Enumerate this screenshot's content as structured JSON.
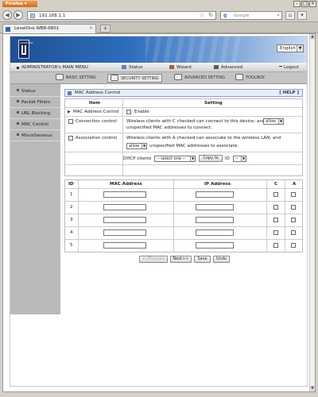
{
  "browser": {
    "app_button": "Firefox",
    "url": "192.168.1.1",
    "search_placeholder": "Google",
    "tab_title": "LevelOne WBR-6801"
  },
  "router": {
    "logo_text": "LevelOne",
    "language": "English",
    "menu": {
      "admin": "ADMINISTRATOR's MAIN MENU",
      "status": "Status",
      "wizard": "Wizard",
      "advanced": "Advanced",
      "logout": "Logout"
    },
    "subtabs": [
      "BASIC SETTING",
      "SECURITY SETTING",
      "ADVANCED SETTING",
      "TOOLBOX"
    ],
    "sidebar": [
      "Status",
      "Packet Filters",
      "URL Blocking",
      "MAC Control",
      "Miscellaneous"
    ]
  },
  "mac_control": {
    "title": "MAC Address Control",
    "help": "[ HELP ]",
    "col_item": "Item",
    "col_setting": "Setting",
    "row1_label": "MAC Address Control",
    "row1_enable": "Enable",
    "row2_label": "Connection control",
    "row2_text1": "Wireless clients with C checked can connect to this device; and",
    "row2_select": "allow",
    "row2_text2": "unspecified MAC addresses to connect.",
    "row3_label": "Association control",
    "row3_text1": "Wireless clients with A checked can associate to the wireless LAN; and",
    "row3_select": "allow",
    "row3_text2": "unspecified MAC addresses to associate.",
    "dhcp_label": "DHCP clients",
    "dhcp_select": "-- select one --",
    "copy_btn": "Copy to",
    "id_label": "ID",
    "id_select": "--",
    "table_headers": [
      "ID",
      "MAC Address",
      "IP Address",
      "C",
      "A"
    ],
    "rows": [
      "1",
      "2",
      "3",
      "4",
      "5"
    ],
    "buttons": [
      "<<Previous",
      "Next>>",
      "Save",
      "Undo"
    ]
  },
  "colors": {
    "banner": "#2e6dbd",
    "sidebar": "#b9b9b9",
    "header_bar": "#e9eef6"
  }
}
